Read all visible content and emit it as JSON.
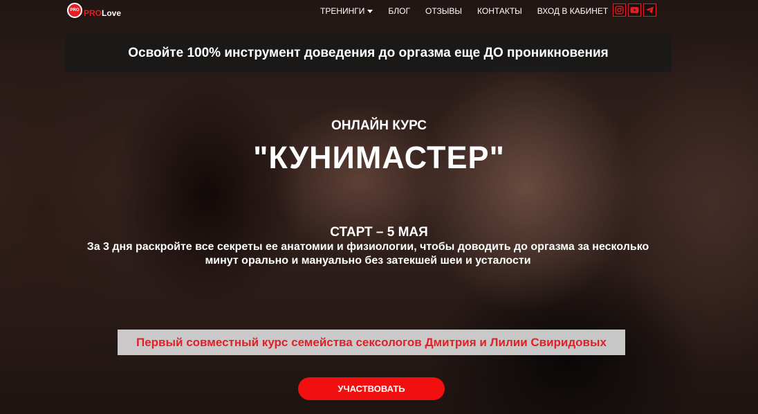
{
  "brand": {
    "mark_text": "PRO",
    "name_part1": "PRO",
    "name_part2": "Love"
  },
  "nav": {
    "items": [
      {
        "label": "ТРЕНИНГИ",
        "has_dropdown": true
      },
      {
        "label": "БЛОГ"
      },
      {
        "label": "ОТЗЫВЫ"
      },
      {
        "label": "КОНТАКТЫ"
      },
      {
        "label": "ВХОД В КАБИНЕТ"
      }
    ]
  },
  "socials": [
    {
      "icon": "instagram-icon"
    },
    {
      "icon": "youtube-icon"
    },
    {
      "icon": "telegram-icon"
    }
  ],
  "hero": {
    "top_banner": "Освойте 100% инструмент доведения до оргазма еще ДО проникновения",
    "subtitle": "ОНЛАЙН КУРС",
    "title": "\"КУНИМАСТЕР\"",
    "start_date": "СТАРТ – 5 МАЯ",
    "description_line1": "За 3 дня раскройте все секреты ее анатомии и физиологии, чтобы доводить до оргазма за несколько",
    "description_line2": "минут орально и мануально без затекшей шеи и усталости",
    "highlight": "Первый совместный курс семейства сексологов Дмитрия и Лилии Свиридовых",
    "cta_label": "УЧАСТВОВАТЬ"
  },
  "colors": {
    "accent": "#e31e24",
    "cta": "#f10f0f",
    "banner_bg": "#191919"
  }
}
